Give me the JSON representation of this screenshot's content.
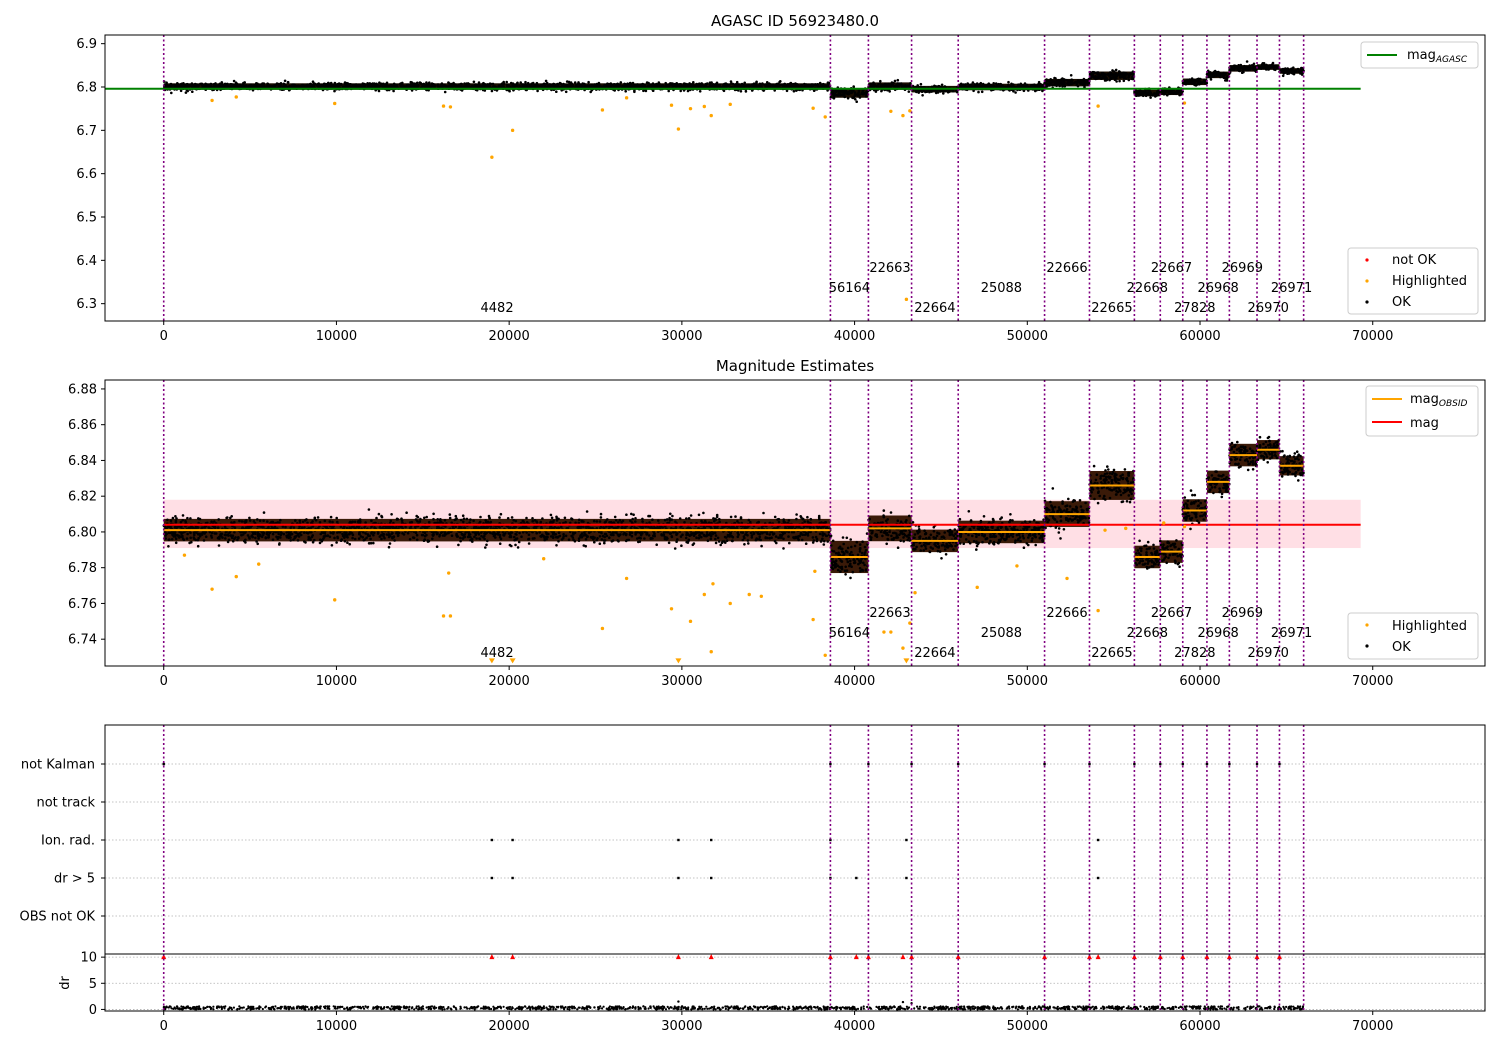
{
  "chart_data": [
    {
      "type": "scatter",
      "title": "AGASC ID 56923480.0",
      "xlim": [
        -3400,
        76500
      ],
      "ylim": [
        6.26,
        6.92
      ],
      "xticks": [
        0,
        10000,
        20000,
        30000,
        40000,
        50000,
        60000,
        70000
      ],
      "yticks": [
        6.3,
        6.4,
        6.5,
        6.6,
        6.7,
        6.8,
        6.9
      ],
      "series": [
        {
          "name": "not OK",
          "color": "#ff0000",
          "points": []
        },
        {
          "name": "Highlighted",
          "color": "#ffa500",
          "points": [
            [
              2800,
              6.769
            ],
            [
              4200,
              6.777
            ],
            [
              9900,
              6.762
            ],
            [
              16200,
              6.756
            ],
            [
              16600,
              6.754
            ],
            [
              19000,
              6.638
            ],
            [
              20200,
              6.7
            ],
            [
              25400,
              6.747
            ],
            [
              26800,
              6.775
            ],
            [
              29400,
              6.758
            ],
            [
              29800,
              6.703
            ],
            [
              30500,
              6.75
            ],
            [
              31300,
              6.755
            ],
            [
              31700,
              6.734
            ],
            [
              32800,
              6.76
            ],
            [
              37600,
              6.751
            ],
            [
              38300,
              6.731
            ],
            [
              42100,
              6.744
            ],
            [
              42800,
              6.734
            ],
            [
              43000,
              6.31
            ],
            [
              43200,
              6.745
            ],
            [
              54100,
              6.756
            ],
            [
              59100,
              6.763
            ]
          ]
        },
        {
          "name": "OK",
          "color": "#000000",
          "points": []
        }
      ],
      "reference_lines": [
        {
          "name": "mag_AGASC",
          "y": 6.796,
          "color": "#008000"
        }
      ],
      "obs_boundaries": [
        0,
        38600,
        40800,
        43300,
        46000,
        51000,
        53600,
        56200,
        57700,
        59000,
        60400,
        61700,
        63300,
        64600,
        66000
      ],
      "obsids": [
        {
          "label": "4482",
          "x": 19300,
          "row": 2
        },
        {
          "label": "56164",
          "x": 39700,
          "row": 1
        },
        {
          "label": "22663",
          "x": 42050,
          "row": 0
        },
        {
          "label": "22664",
          "x": 44650,
          "row": 2
        },
        {
          "label": "25088",
          "x": 48500,
          "row": 1
        },
        {
          "label": "22666",
          "x": 52300,
          "row": 0
        },
        {
          "label": "22665",
          "x": 54900,
          "row": 2
        },
        {
          "label": "22668",
          "x": 56950,
          "row": 1
        },
        {
          "label": "22667",
          "x": 58350,
          "row": 0
        },
        {
          "label": "27828",
          "x": 59700,
          "row": 2
        },
        {
          "label": "26968",
          "x": 61050,
          "row": 1
        },
        {
          "label": "26969",
          "x": 62450,
          "row": 0
        },
        {
          "label": "26970",
          "x": 63950,
          "row": 2
        },
        {
          "label": "26971",
          "x": 65300,
          "row": 1
        }
      ],
      "segments": [
        {
          "x0": 0,
          "x1": 38600,
          "y": 6.801,
          "spread": 0.007
        },
        {
          "x0": 38600,
          "x1": 40800,
          "y": 6.786,
          "spread": 0.01
        },
        {
          "x0": 40800,
          "x1": 43300,
          "y": 6.802,
          "spread": 0.008
        },
        {
          "x0": 43300,
          "x1": 46000,
          "y": 6.795,
          "spread": 0.007
        },
        {
          "x0": 46000,
          "x1": 51000,
          "y": 6.8,
          "spread": 0.007
        },
        {
          "x0": 51000,
          "x1": 53600,
          "y": 6.81,
          "spread": 0.008
        },
        {
          "x0": 53600,
          "x1": 56200,
          "y": 6.826,
          "spread": 0.009
        },
        {
          "x0": 56200,
          "x1": 57700,
          "y": 6.786,
          "spread": 0.007
        },
        {
          "x0": 57700,
          "x1": 59000,
          "y": 6.789,
          "spread": 0.007
        },
        {
          "x0": 59000,
          "x1": 60400,
          "y": 6.812,
          "spread": 0.007
        },
        {
          "x0": 60400,
          "x1": 61700,
          "y": 6.828,
          "spread": 0.007
        },
        {
          "x0": 61700,
          "x1": 63300,
          "y": 6.843,
          "spread": 0.007
        },
        {
          "x0": 63300,
          "x1": 64600,
          "y": 6.846,
          "spread": 0.006
        },
        {
          "x0": 64600,
          "x1": 66000,
          "y": 6.837,
          "spread": 0.006
        }
      ],
      "legend_upper": [
        {
          "label": "mag",
          "sub": "AGASC",
          "color": "#008000"
        }
      ],
      "legend_lower": [
        {
          "label": "not OK",
          "color": "#ff0000"
        },
        {
          "label": "Highlighted",
          "color": "#ffa500"
        },
        {
          "label": "OK",
          "color": "#000000"
        }
      ],
      "legend_position": "top-right and bottom-right"
    },
    {
      "type": "scatter",
      "title": "Magnitude Estimates",
      "xlim": [
        -3400,
        76500
      ],
      "ylim": [
        6.725,
        6.885
      ],
      "xticks": [
        0,
        10000,
        20000,
        30000,
        40000,
        50000,
        60000,
        70000
      ],
      "yticks": [
        6.74,
        6.76,
        6.78,
        6.8,
        6.82,
        6.84,
        6.86,
        6.88
      ],
      "series": [
        {
          "name": "Highlighted",
          "color": "#ffa500",
          "points": [
            [
              1200,
              6.787
            ],
            [
              2800,
              6.768
            ],
            [
              4200,
              6.775
            ],
            [
              5500,
              6.782
            ],
            [
              9900,
              6.762
            ],
            [
              16200,
              6.753
            ],
            [
              16600,
              6.753
            ],
            [
              16500,
              6.777
            ],
            [
              19000,
              6.727
            ],
            [
              20200,
              6.727
            ],
            [
              22000,
              6.785
            ],
            [
              25400,
              6.746
            ],
            [
              26800,
              6.774
            ],
            [
              29400,
              6.757
            ],
            [
              29800,
              6.727
            ],
            [
              30500,
              6.75
            ],
            [
              31300,
              6.765
            ],
            [
              31700,
              6.733
            ],
            [
              31800,
              6.771
            ],
            [
              32800,
              6.76
            ],
            [
              33900,
              6.765
            ],
            [
              34600,
              6.764
            ],
            [
              37600,
              6.751
            ],
            [
              37700,
              6.778
            ],
            [
              38300,
              6.731
            ],
            [
              41700,
              6.744
            ],
            [
              42100,
              6.744
            ],
            [
              42800,
              6.735
            ],
            [
              43000,
              6.727
            ],
            [
              43200,
              6.749
            ],
            [
              43500,
              6.766
            ],
            [
              47100,
              6.769
            ],
            [
              49400,
              6.781
            ],
            [
              52300,
              6.774
            ],
            [
              54100,
              6.756
            ],
            [
              54500,
              6.801
            ],
            [
              55700,
              6.802
            ],
            [
              59100,
              6.803
            ],
            [
              57900,
              6.805
            ]
          ]
        },
        {
          "name": "OK",
          "color": "#000000",
          "points": []
        }
      ],
      "reference_lines": [
        {
          "name": "mag",
          "y": 6.804,
          "band": [
            6.791,
            6.818
          ],
          "color": "#ff0000"
        }
      ],
      "legend_upper": [
        {
          "label": "mag",
          "sub": "OBSID",
          "color": "#ffa500"
        },
        {
          "label": "mag",
          "sub": "",
          "color": "#ff0000"
        }
      ],
      "legend_lower": [
        {
          "label": "Highlighted",
          "color": "#ffa500"
        },
        {
          "label": "OK",
          "color": "#000000"
        }
      ],
      "legend_position": "top-right and bottom-right"
    },
    {
      "type": "scatter",
      "title": "",
      "categories": [
        "not Kalman",
        "not track",
        "Ion. rad.",
        "dr > 5",
        "OBS not OK"
      ],
      "flags": {
        "not Kalman": [
          0,
          38600,
          40800,
          43300,
          46000,
          51000,
          53600,
          56200,
          57700,
          59000,
          60400,
          61700,
          63300,
          64600
        ],
        "not track": [],
        "Ion. rad.": [
          19000,
          20200,
          29800,
          31700,
          38600,
          43000,
          54100
        ],
        "dr > 5": [
          19000,
          20200,
          29800,
          31700,
          38600,
          40100,
          43000,
          54100
        ],
        "OBS not OK": []
      },
      "dr": {
        "ylabel": "dr",
        "yticks": [
          0,
          5,
          10
        ],
        "ylim": [
          -0.3,
          10.6
        ],
        "baseline_range": [
          0,
          0.6
        ],
        "spikes_at_10": [
          0,
          19000,
          20200,
          29800,
          31700,
          38600,
          40100,
          40800,
          42800,
          43300,
          46000,
          51000,
          53600,
          54100,
          56200,
          57700,
          59000,
          60400,
          61700,
          63300,
          64600
        ],
        "spikes_small": [
          [
            29800,
            1.5
          ],
          [
            42800,
            1.4
          ],
          [
            43300,
            1.2
          ]
        ]
      }
    }
  ],
  "legend_texts": {
    "not_ok": "not OK",
    "highlighted": "Highlighted",
    "ok": "OK",
    "mag": "mag",
    "agasc_sub": "AGASC",
    "obsid_sub": "OBSID"
  }
}
